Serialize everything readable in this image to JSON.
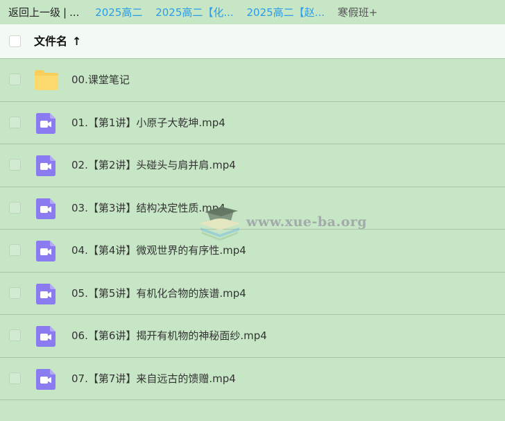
{
  "breadcrumb": {
    "back_label": "返回上一级",
    "separator": "|",
    "ellipsis": "...",
    "chevron": "›",
    "links": [
      "2025高二",
      "2025高二【化...",
      "2025高二【赵..."
    ],
    "current": "寒假班+"
  },
  "header": {
    "name_column": "文件名",
    "sort_indicator": "↑"
  },
  "files": [
    {
      "name": "00.课堂笔记",
      "type": "folder",
      "icon": "folder-icon"
    },
    {
      "name": "01.【第1讲】小原子大乾坤.mp4",
      "type": "video",
      "icon": "video-file-icon"
    },
    {
      "name": "02.【第2讲】头碰头与肩并肩.mp4",
      "type": "video",
      "icon": "video-file-icon"
    },
    {
      "name": "03.【第3讲】结构决定性质.mp4",
      "type": "video",
      "icon": "video-file-icon"
    },
    {
      "name": "04.【第4讲】微观世界的有序性.mp4",
      "type": "video",
      "icon": "video-file-icon"
    },
    {
      "name": "05.【第5讲】有机化合物的族谱.mp4",
      "type": "video",
      "icon": "video-file-icon"
    },
    {
      "name": "06.【第6讲】揭开有机物的神秘面纱.mp4",
      "type": "video",
      "icon": "video-file-icon"
    },
    {
      "name": "07.【第7讲】来自远古的馈赠.mp4",
      "type": "video",
      "icon": "video-file-icon"
    }
  ],
  "watermark": {
    "text": "www.xue-ba.org"
  },
  "colors": {
    "background": "#c7e6c6",
    "link": "#2a9be8",
    "folder": "#f9cf5c",
    "video": "#8a7cf0"
  }
}
